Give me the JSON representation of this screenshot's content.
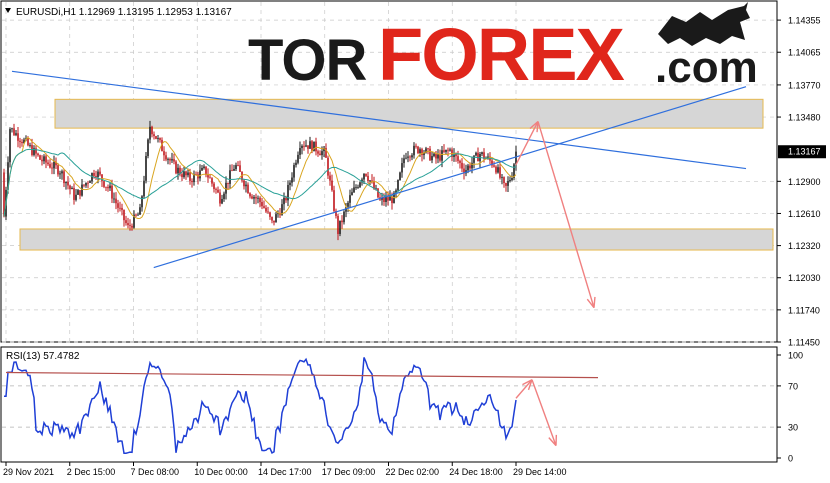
{
  "header": {
    "symbol_info": "EURUSDi,H1  1.12969 1.13195 1.12953 1.13167"
  },
  "logo": {
    "part1": "TOR",
    "part2": "FOREX",
    "part3": ".com",
    "colors": {
      "dark": "#1a1a1a",
      "accent": "#e0261b"
    }
  },
  "colors": {
    "up_candle": "#1a1a1a",
    "down_candle": "#c0141a",
    "ma_fast": "#d9a520",
    "ma_slow": "#2aa198",
    "trendline": "#2f6fdd",
    "zone_fill": "#d6d6d6",
    "zone_border": "#e6b94f",
    "forecast_arrow": "#f08080",
    "rsi_line": "#1f3fd6",
    "rsi_trend": "#b5504d"
  },
  "chart_data": [
    {
      "type": "candlestick",
      "symbol": "EURUSDi",
      "timeframe": "H1",
      "ohlc_last": {
        "open": 1.12969,
        "high": 1.13195,
        "low": 1.12953,
        "close": 1.13167
      },
      "ylim": [
        1.1145,
        1.1441
      ],
      "y_ticks": [
        "1.14355",
        "1.14065",
        "1.13770",
        "1.13480",
        "1.13167",
        "1.12900",
        "1.12610",
        "1.12320",
        "1.12030",
        "1.11740",
        "1.11450"
      ],
      "current_price_label": "1.13167",
      "x_ticks": [
        "29 Nov 2021",
        "2 Dec 15:00",
        "7 Dec 08:00",
        "10 Dec 00:00",
        "14 Dec 17:00",
        "17 Dec 09:00",
        "22 Dec 02:00",
        "24 Dec 18:00",
        "29 Dec 14:00"
      ],
      "resistance_zone": [
        1.1338,
        1.1364
      ],
      "support_zone": [
        1.1228,
        1.1247
      ],
      "trendlines": [
        {
          "name": "upper",
          "from": [
            "29 Nov 2021",
            1.139
          ],
          "to": [
            "29 Dec 14:00",
            1.1329
          ]
        },
        {
          "name": "lower",
          "from": [
            "2 Dec 15:00",
            1.1189
          ],
          "to": [
            "29 Dec 14:00",
            1.1312
          ]
        }
      ],
      "forecast_path": [
        1.1305,
        1.1344,
        1.1176
      ],
      "moving_averages": 2,
      "grid": true
    },
    {
      "type": "line",
      "indicator": "RSI",
      "title": "RSI(13) 57.4782",
      "period": 13,
      "value": 57.4782,
      "ylim": [
        0,
        100
      ],
      "y_ticks": [
        "100",
        "70",
        "30",
        "0"
      ],
      "levels": [
        70,
        30
      ],
      "trendline": [
        83,
        78
      ],
      "forecast_path": [
        58,
        76,
        12
      ]
    }
  ]
}
